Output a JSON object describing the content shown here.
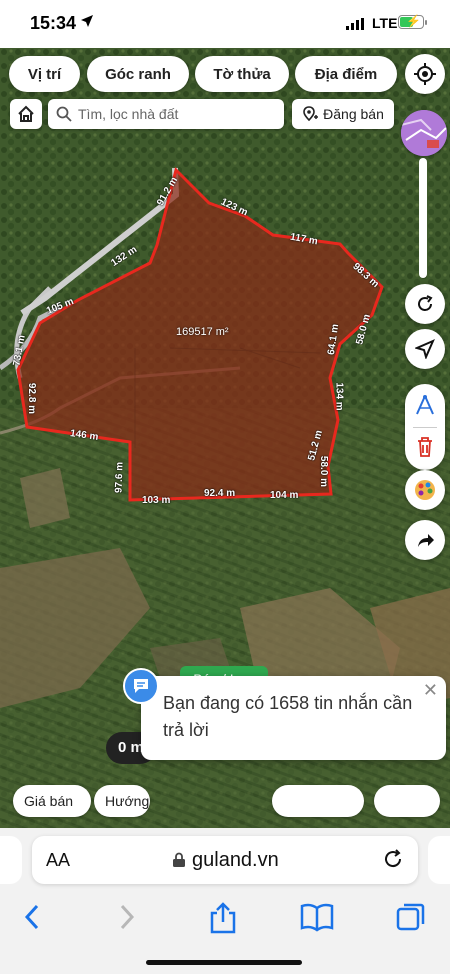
{
  "status_bar": {
    "time": "15:34",
    "network": "LTE"
  },
  "map_toolbar": {
    "tabs": [
      "Vị trí",
      "Góc ranh",
      "Tờ thửa",
      "Địa điểm"
    ],
    "search_placeholder": "Tìm, lọc nhà đất",
    "post_label": "Đăng bán"
  },
  "parcel": {
    "area": "169517 m²",
    "edge_labels": [
      "91.2 m",
      "123 m",
      "117 m",
      "98.3 m",
      "132 m",
      "105 m",
      "73.1 m",
      "92.8 m",
      "146 m",
      "97.6 m",
      "103 m",
      "92.4 m",
      "104 m",
      "64.1 m",
      "58.0 m",
      "134 m",
      "51.2 m",
      "58.0 m"
    ]
  },
  "map_overlay": {
    "sale_badge": "Bán / Lưu",
    "counter": "0 m",
    "bottom_filters": [
      "Giá bán",
      "Hướng"
    ]
  },
  "message_popup": {
    "text": "Bạn đang có 1658 tin nhắn cần trả lời"
  },
  "browser": {
    "text_size": "AA",
    "domain": "guland.vn"
  },
  "colors": {
    "parcel_outline": "#e8281e",
    "badge_green": "#2fa84f",
    "marker_yellow": "#f4c21a",
    "accent_blue": "#1a73e8"
  }
}
